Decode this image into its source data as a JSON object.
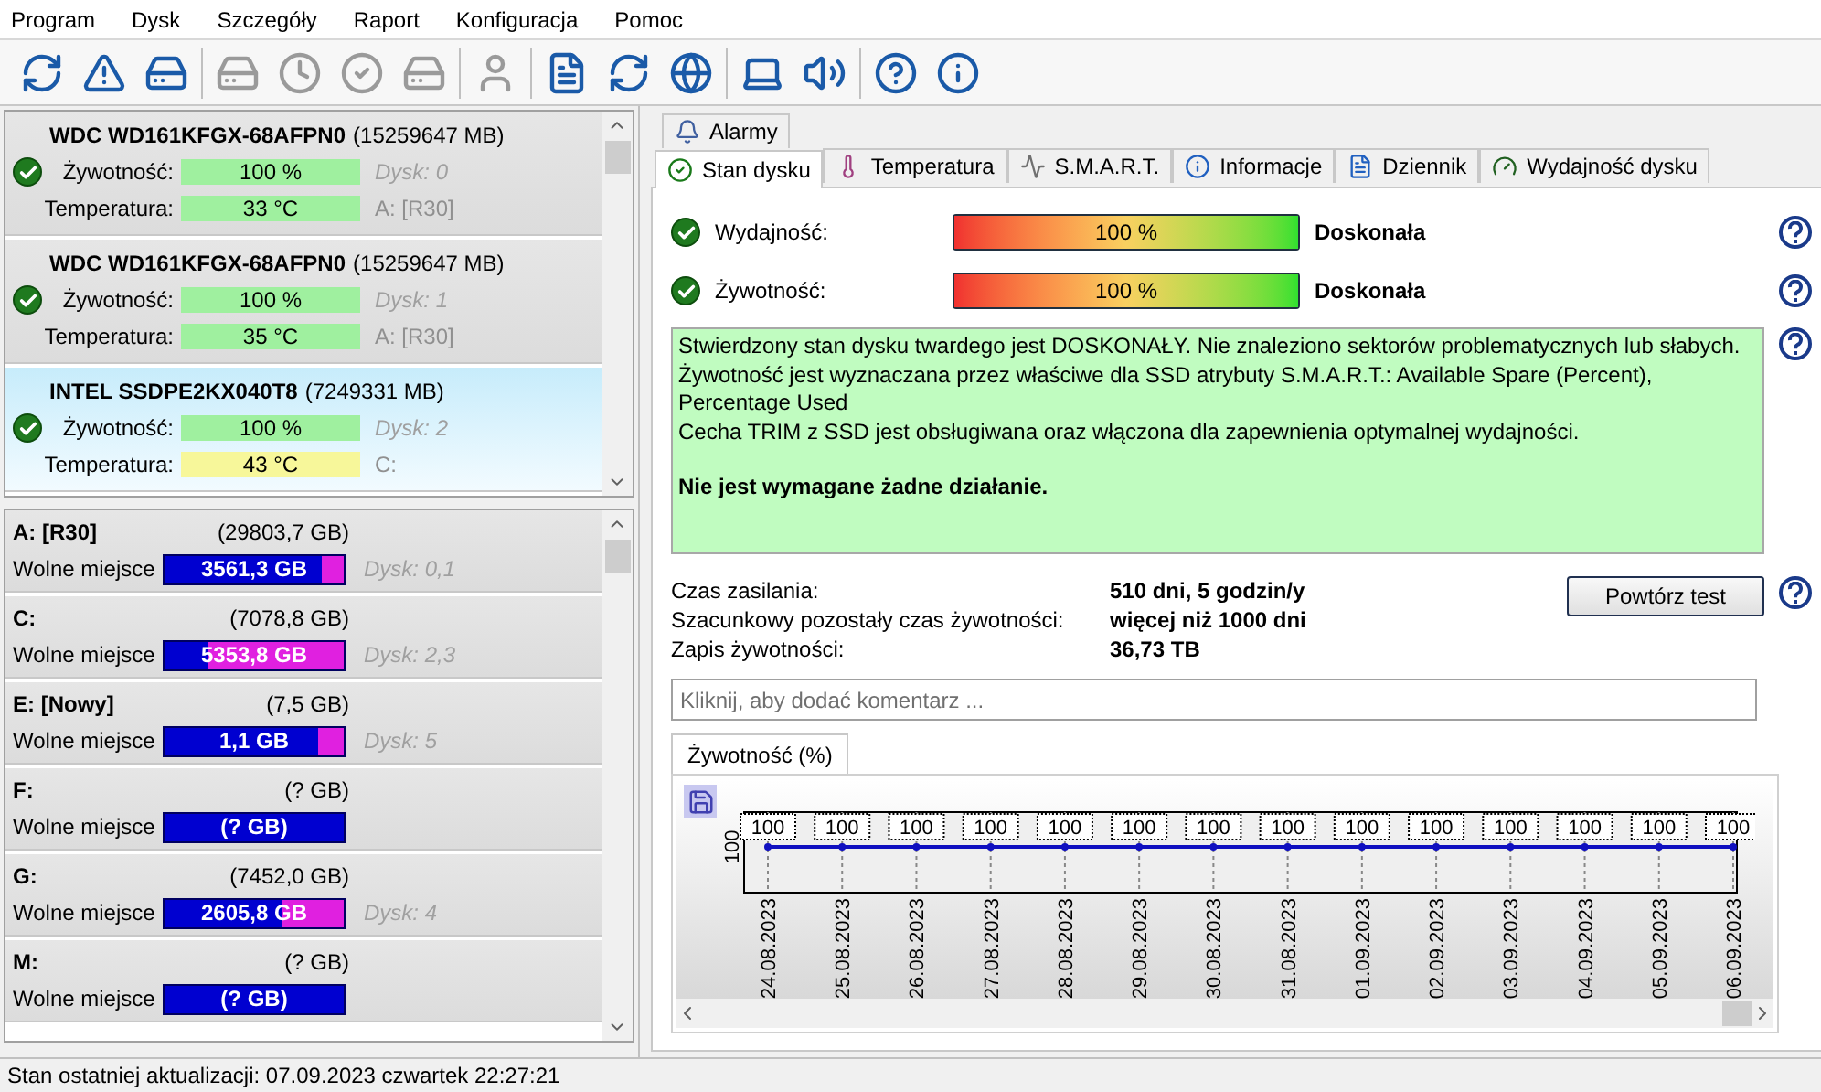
{
  "menu": [
    "Program",
    "Dysk",
    "Szczegóły",
    "Raport",
    "Konfiguracja",
    "Pomoc"
  ],
  "toolbar_groups": [
    {
      "items": [
        {
          "kind": "refresh",
          "disabled": false
        },
        {
          "kind": "alert",
          "disabled": false
        },
        {
          "kind": "drive",
          "disabled": false
        }
      ]
    },
    {
      "items": [
        {
          "kind": "drive",
          "disabled": true
        },
        {
          "kind": "drive-clock",
          "disabled": true
        },
        {
          "kind": "drive-check",
          "disabled": true
        },
        {
          "kind": "drive",
          "disabled": true
        }
      ]
    },
    {
      "items": [
        {
          "kind": "head",
          "disabled": true
        }
      ]
    },
    {
      "items": [
        {
          "kind": "document",
          "disabled": false
        },
        {
          "kind": "refresh",
          "disabled": false
        },
        {
          "kind": "network",
          "disabled": false
        }
      ]
    },
    {
      "items": [
        {
          "kind": "laptop",
          "disabled": false
        },
        {
          "kind": "speaker",
          "disabled": false
        }
      ]
    },
    {
      "items": [
        {
          "kind": "help",
          "disabled": false
        },
        {
          "kind": "info",
          "disabled": false
        }
      ]
    }
  ],
  "disks": [
    {
      "name": "WDC WD161KFGX-68AFPN0",
      "size": "(15259647 MB)",
      "selected": false,
      "health_label": "Żywotność:",
      "health": "100 %",
      "disk_no": "Dysk: 0",
      "temp_label": "Temperatura:",
      "temperature": {
        "text": "33 °C",
        "color": "#9ff09f"
      },
      "volume": "A: [R30]"
    },
    {
      "name": "WDC WD161KFGX-68AFPN0",
      "size": "(15259647 MB)",
      "selected": false,
      "health_label": "Żywotność:",
      "health": "100 %",
      "disk_no": "Dysk: 1",
      "temp_label": "Temperatura:",
      "temperature": {
        "text": "35 °C",
        "color": "#9ff09f"
      },
      "volume": "A: [R30]"
    },
    {
      "name": "INTEL SSDPE2KX040T8",
      "size": "(7249331 MB)",
      "selected": true,
      "health_label": "Żywotność:",
      "health": "100 %",
      "disk_no": "Dysk: 2",
      "temp_label": "Temperatura:",
      "temperature": {
        "text": "43 °C",
        "color": "#f7f79a"
      },
      "volume": "C:"
    }
  ],
  "volumes": [
    {
      "name": "A: [R30]",
      "size": "(29803,7 GB)",
      "label": "Wolne miejsce",
      "free": "3561,3 GB",
      "level": 0.12,
      "disks": "Dysk: 0,1"
    },
    {
      "name": "C:",
      "size": "(7078,8 GB)",
      "label": "Wolne miejsce",
      "free": "5353,8 GB",
      "level": 0.76,
      "disks": "Dysk: 2,3"
    },
    {
      "name": "E: [Nowy]",
      "size": "(7,5 GB)",
      "label": "Wolne miejsce",
      "free": "1,1 GB",
      "level": 0.14,
      "disks": "Dysk: 5"
    },
    {
      "name": "F:",
      "size": "(? GB)",
      "label": "Wolne miejsce",
      "free": "(? GB)"
    },
    {
      "name": "G:",
      "size": "(7452,0 GB)",
      "label": "Wolne miejsce",
      "free": "2605,8 GB",
      "level": 0.35,
      "disks": "Dysk: 4"
    },
    {
      "name": "M:",
      "size": "(? GB)",
      "label": "Wolne miejsce",
      "free": "(? GB)"
    }
  ],
  "status_bar": "Stan ostatniej aktualizacji: 07.09.2023 czwartek 22:27:21",
  "tabs_top": [
    {
      "label": "Alarmy",
      "kind": "alarm",
      "selected": false
    }
  ],
  "tabs": [
    {
      "label": "Stan dysku",
      "kind": "check",
      "selected": true
    },
    {
      "label": "Temperatura",
      "kind": "thermo",
      "selected": false
    },
    {
      "label": "S.M.A.R.T.",
      "kind": "smart",
      "selected": false
    },
    {
      "label": "Informacje",
      "kind": "info",
      "selected": false
    },
    {
      "label": "Dziennik",
      "kind": "log",
      "selected": false
    },
    {
      "label": "Wydajność dysku",
      "kind": "gauge",
      "selected": false
    }
  ],
  "meters": [
    {
      "label": "Wydajność:",
      "level": 1.0,
      "reading": "100 %",
      "verdict": "Doskonała"
    },
    {
      "label": "Żywotność:",
      "level": 1.0,
      "reading": "100 %",
      "verdict": "Doskonała"
    }
  ],
  "summary": [
    "Stwierdzony stan dysku twardego jest DOSKONAŁY. Nie znaleziono sektorów problematycznych lub słabych.",
    "Żywotność jest wyznaczana przez właściwe dla SSD atrybuty S.M.A.R.T.:  Available Spare (Percent), Percentage Used",
    "Cecha TRIM z SSD jest obsługiwana oraz włączona dla zapewnienia optymalnej wydajności."
  ],
  "summary_action": "Nie jest wymagane żadne działanie.",
  "stats": [
    {
      "label": "Czas zasilania:",
      "value": "510 dni, 5 godzin/y"
    },
    {
      "label": "Szacunkowy pozostały czas żywotności:",
      "value": "więcej niż 1000 dni"
    },
    {
      "label": "Zapis żywotności:",
      "value": "36,73 TB"
    }
  ],
  "retest_button": "Powtórz test",
  "comment": {
    "placeholder": "Kliknij, aby dodać komentarz ..."
  },
  "lifetime_chart": {
    "tab": "Żywotność (%)",
    "y_tick": "100",
    "dates": [
      "24.08.2023",
      "25.08.2023",
      "26.08.2023",
      "27.08.2023",
      "28.08.2023",
      "29.08.2023",
      "30.08.2023",
      "31.08.2023",
      "01.09.2023",
      "02.09.2023",
      "03.09.2023",
      "04.09.2023",
      "05.09.2023",
      "06.09.2023"
    ],
    "point_labels": [
      "100",
      "100",
      "100",
      "100",
      "100",
      "100",
      "100",
      "100",
      "100",
      "100",
      "100",
      "100",
      "100",
      "100"
    ]
  }
}
